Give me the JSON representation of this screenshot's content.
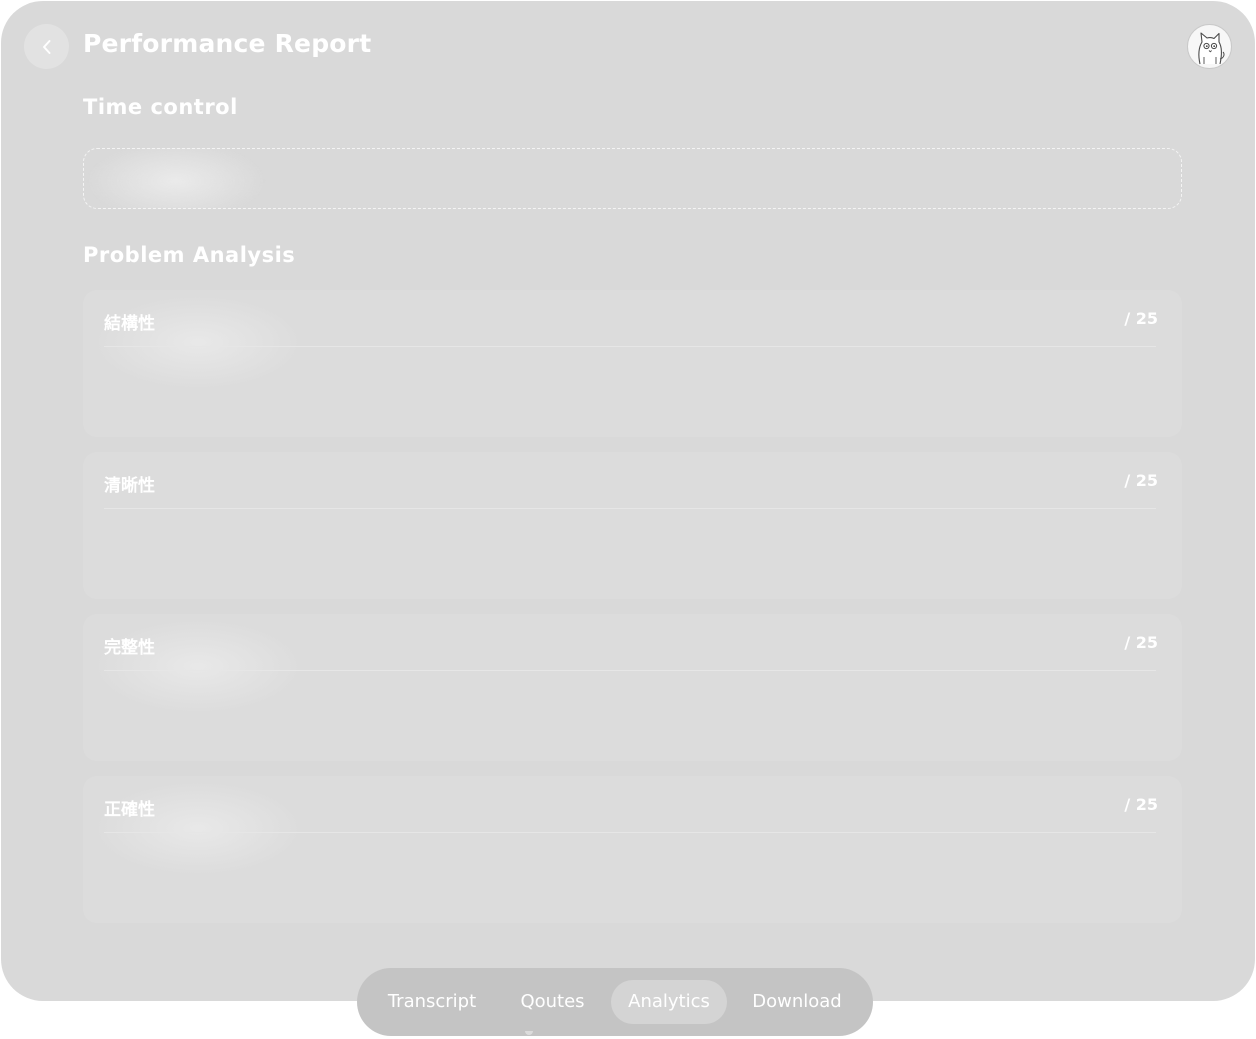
{
  "header": {
    "title": "Performance Report",
    "back_icon": "chevron-left-icon",
    "avatar_icon": "cat-avatar-icon"
  },
  "time_control": {
    "title": "Time control"
  },
  "problem_analysis": {
    "title": "Problem Analysis",
    "cards": [
      {
        "label": "結構性",
        "score": "/ 25"
      },
      {
        "label": "清晰性",
        "score": "/ 25"
      },
      {
        "label": "完整性",
        "score": "/ 25"
      },
      {
        "label": "正確性",
        "score": "/ 25"
      }
    ]
  },
  "bottom_nav": {
    "items": [
      {
        "label": "Transcript"
      },
      {
        "label": "Qoutes"
      },
      {
        "label": "Analytics"
      },
      {
        "label": "Download"
      }
    ],
    "active": "Analytics"
  },
  "colors": {
    "background": "#d9d9d9",
    "card": "#dcdcdc",
    "nav": "#c4c4c4",
    "nav_active": "#d4d4d4",
    "text": "#ffffff"
  }
}
